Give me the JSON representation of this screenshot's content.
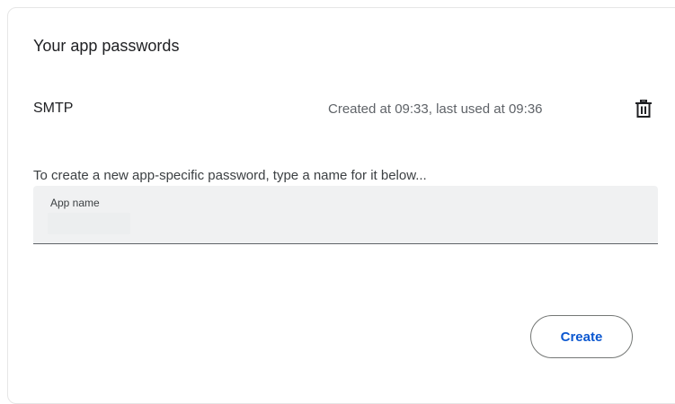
{
  "card": {
    "title": "Your app passwords"
  },
  "passwords": [
    {
      "name": "SMTP",
      "meta": "Created at 09:33, last used at 09:36",
      "delete_icon": "trash-icon"
    }
  ],
  "new_password": {
    "helper_text": "To create a new app-specific password, type a name for it below...",
    "field_label": "App name",
    "field_value": ""
  },
  "actions": {
    "create_label": "Create"
  },
  "colors": {
    "accent": "#0b57d0",
    "field_background": "#f0f1f2",
    "border": "#747775",
    "secondary_text": "#5f6368"
  }
}
